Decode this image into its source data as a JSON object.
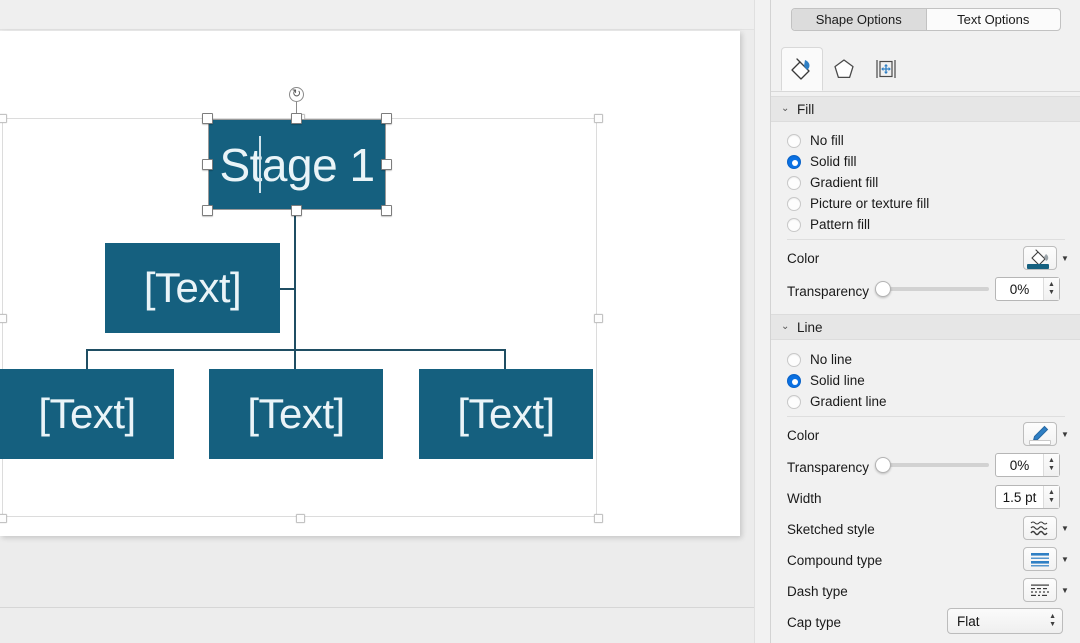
{
  "canvas": {
    "nodes": [
      {
        "label": "Stage 1",
        "level": "root"
      },
      {
        "label": "[Text]",
        "level": "lvl2"
      },
      {
        "label": "[Text]",
        "level": "lvl3"
      },
      {
        "label": "[Text]",
        "level": "lvl3"
      },
      {
        "label": "[Text]",
        "level": "lvl3"
      }
    ],
    "shape_fill_color": "#15607f",
    "text_color": "#eaf4f8",
    "connector_color": "#1f4e63",
    "rotate_handle_icon": "rotate-icon",
    "rotate_handle_glyph": "↻"
  },
  "pane": {
    "tabs": [
      {
        "label": "Shape Options",
        "active": true
      },
      {
        "label": "Text Options",
        "active": false
      }
    ],
    "icon_tabs": [
      {
        "name": "fill-and-line-icon",
        "active": true
      },
      {
        "name": "effects-icon",
        "active": false
      },
      {
        "name": "size-and-properties-icon",
        "active": false
      }
    ],
    "fill": {
      "title": "Fill",
      "expanded_glyph": "⌄",
      "options": [
        {
          "label": "No fill",
          "selected": false
        },
        {
          "label": "Solid fill",
          "selected": true
        },
        {
          "label": "Gradient fill",
          "selected": false
        },
        {
          "label": "Picture or texture fill",
          "selected": false
        },
        {
          "label": "Pattern fill",
          "selected": false
        }
      ],
      "color_label": "Color",
      "color_icon": "fill-bucket-icon",
      "color_swatch": "#15607f",
      "transparency_label": "Transparency",
      "transparency_value": "0%"
    },
    "line": {
      "title": "Line",
      "expanded_glyph": "⌄",
      "options": [
        {
          "label": "No line",
          "selected": false
        },
        {
          "label": "Solid line",
          "selected": true
        },
        {
          "label": "Gradient line",
          "selected": false
        }
      ],
      "color_label": "Color",
      "color_icon": "line-pencil-icon",
      "color_swatch": "#ffffff",
      "transparency_label": "Transparency",
      "transparency_value": "0%",
      "width_label": "Width",
      "width_value": "1.5 pt",
      "sketched_label": "Sketched style",
      "sketched_icon": "sketched-style-icon",
      "compound_label": "Compound type",
      "compound_icon": "compound-type-icon",
      "dash_label": "Dash type",
      "dash_icon": "dash-type-icon",
      "cap_label": "Cap type",
      "cap_value": "Flat"
    }
  },
  "accent_blue": "#0a71e4"
}
